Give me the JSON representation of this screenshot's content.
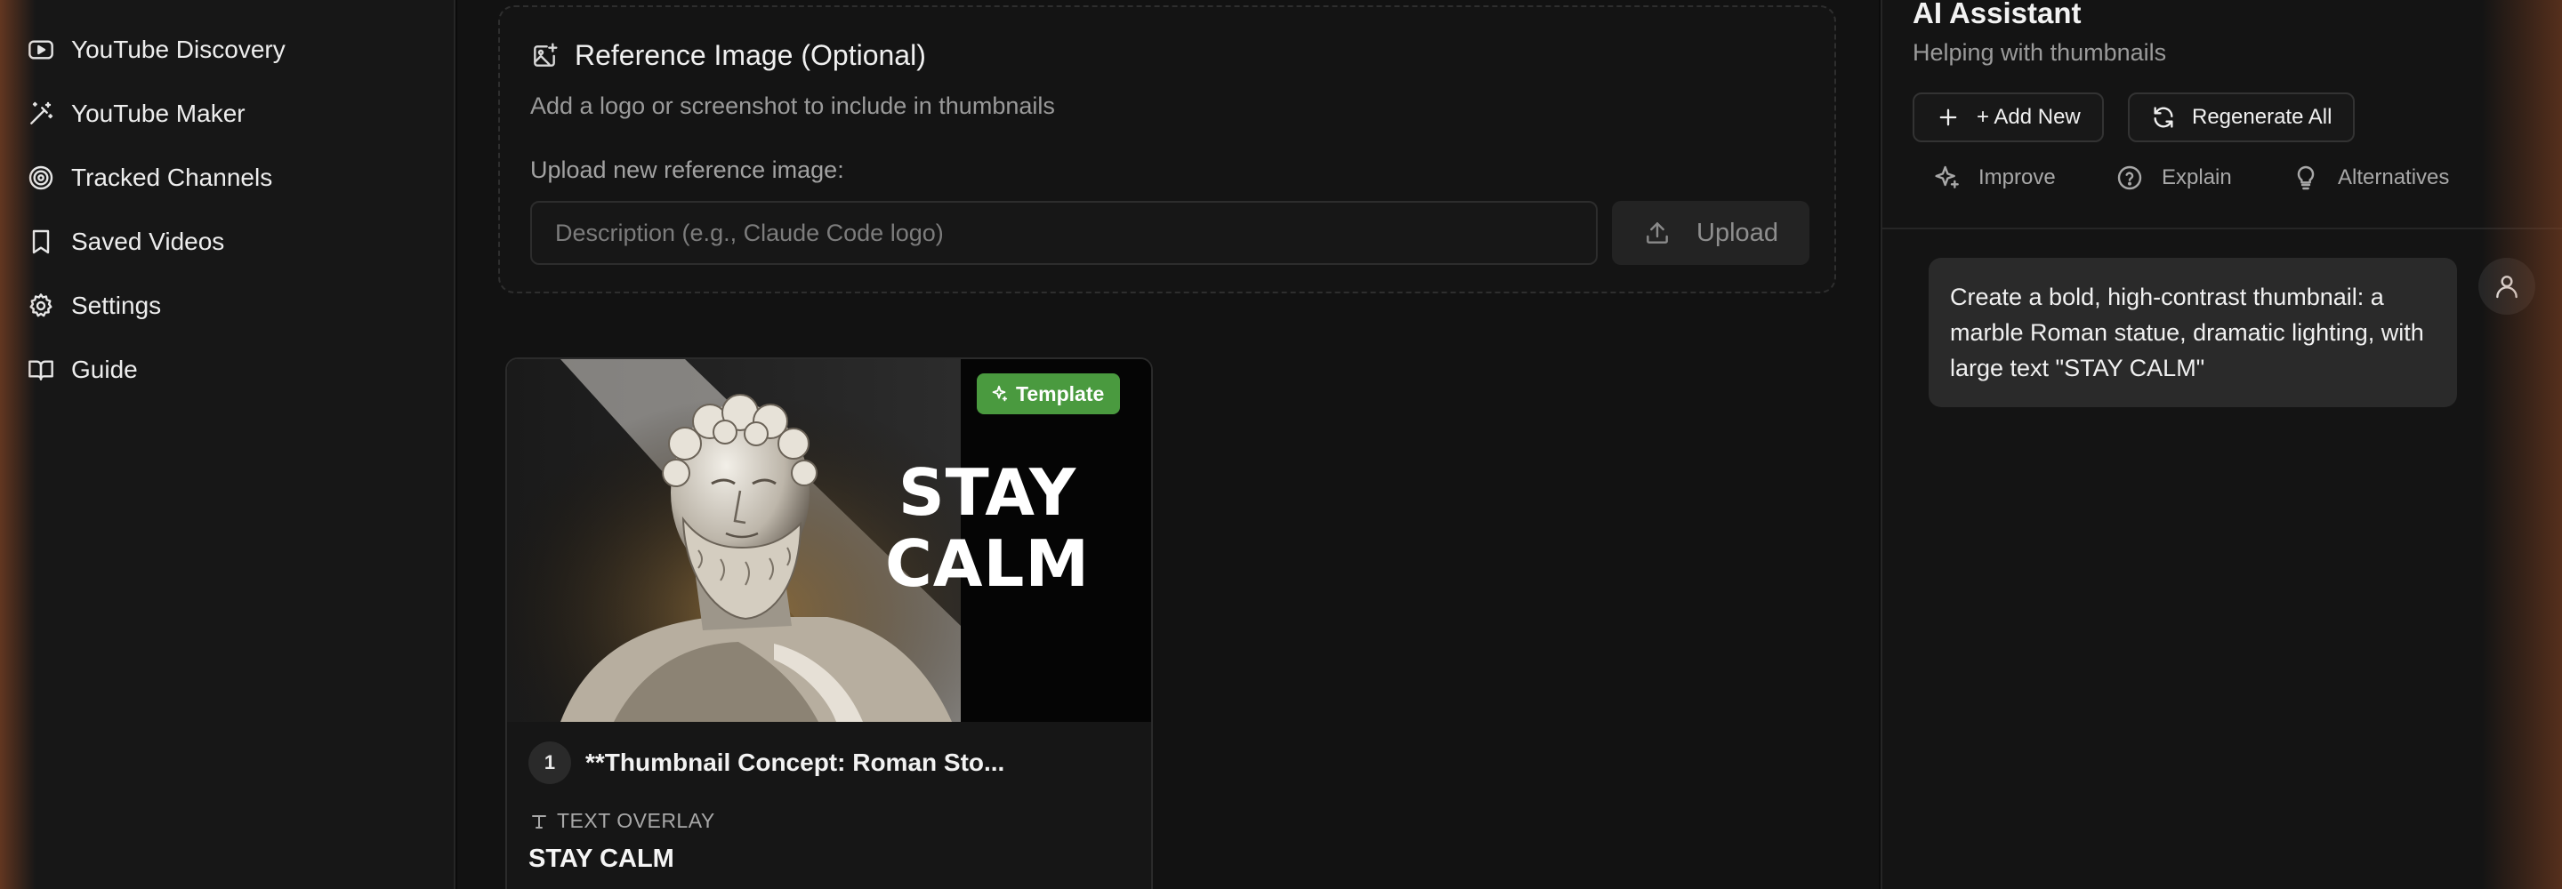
{
  "sidebar": {
    "items": [
      {
        "label": "YouTube Discovery",
        "icon": "youtube-icon"
      },
      {
        "label": "YouTube Maker",
        "icon": "magic-wand-icon"
      },
      {
        "label": "Tracked Channels",
        "icon": "target-icon"
      },
      {
        "label": "Saved Videos",
        "icon": "bookmark-icon"
      },
      {
        "label": "Settings",
        "icon": "gear-icon"
      },
      {
        "label": "Guide",
        "icon": "book-icon"
      }
    ]
  },
  "reference": {
    "title": "Reference Image (Optional)",
    "subtitle": "Add a logo or screenshot to include in thumbnails",
    "upload_label": "Upload new reference image:",
    "description_placeholder": "Description (e.g., Claude Code logo)",
    "description_value": "",
    "upload_button": "Upload"
  },
  "thumbnail_card": {
    "badge": "Template",
    "image_text_line1": "STAY",
    "image_text_line2": "CALM",
    "number": "1",
    "concept_title": "**Thumbnail Concept: Roman Sto...",
    "overlay_label": "TEXT OVERLAY",
    "overlay_value": "STAY CALM"
  },
  "assistant": {
    "title": "AI Assistant",
    "subtitle": "Helping with thumbnails",
    "add_new_button": "+ Add New",
    "regenerate_button": "Regenerate All",
    "actions": [
      "Improve",
      "Explain",
      "Alternatives"
    ],
    "messages": [
      {
        "role": "user",
        "text": "Create a bold, high-contrast thumbnail: a marble Roman statue, dramatic lighting, with large text \"STAY CALM\""
      }
    ]
  },
  "colors": {
    "background": "#121212",
    "sidebar": "#171717",
    "template_badge": "#4a9a3f",
    "accent_glow": "#a05028"
  }
}
